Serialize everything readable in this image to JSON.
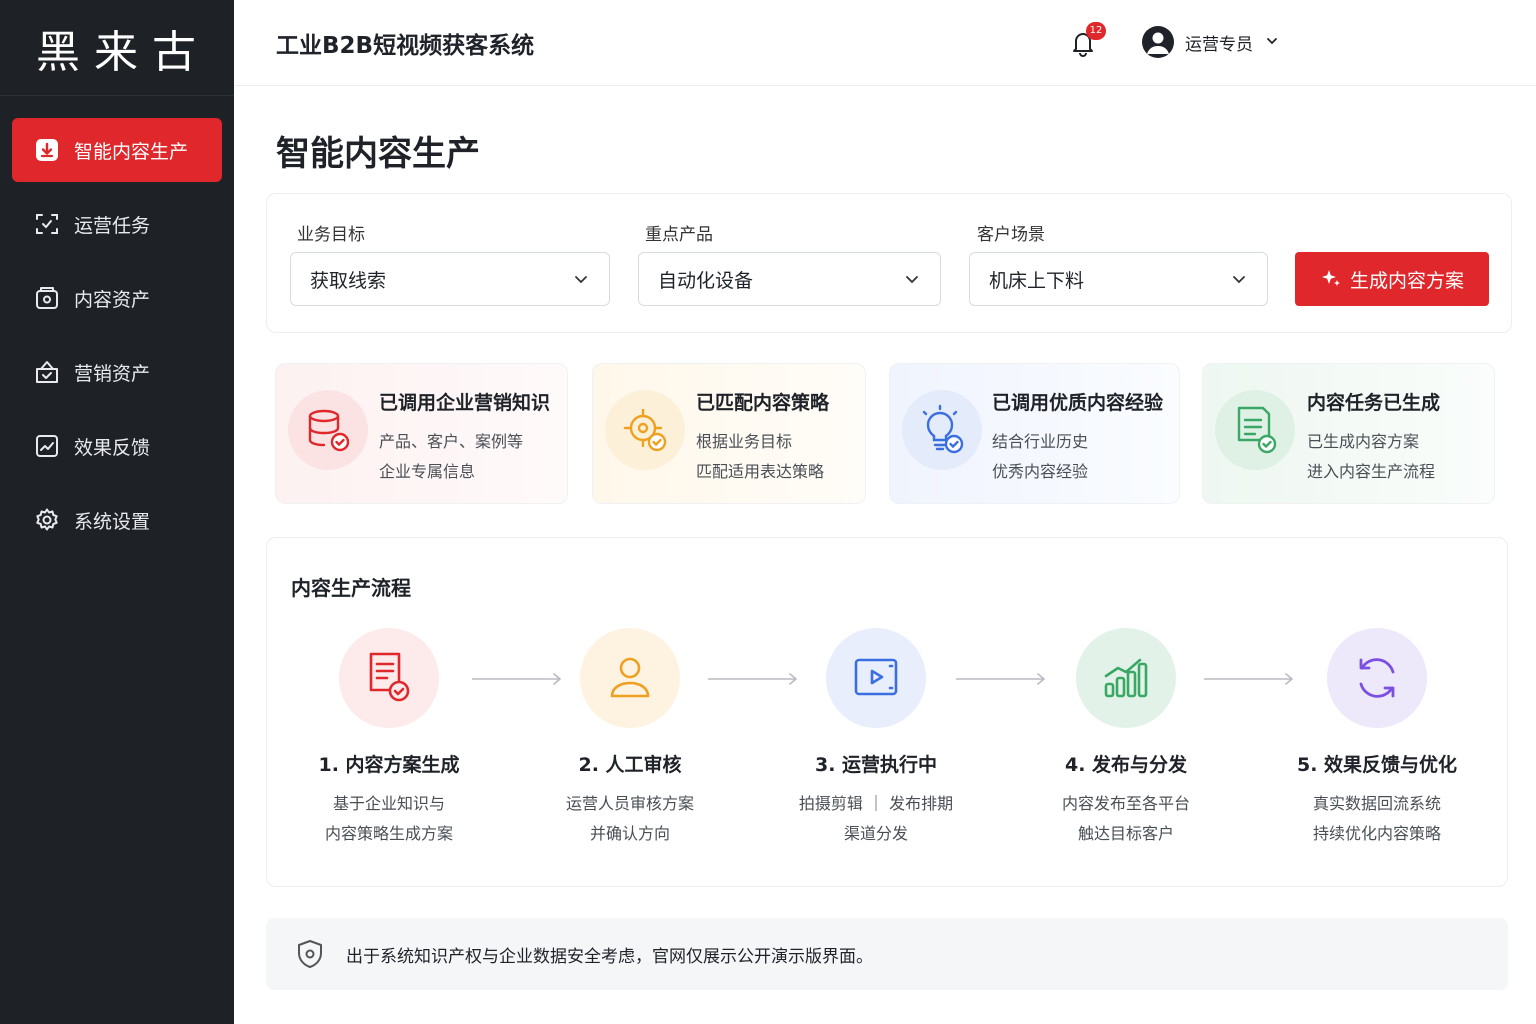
{
  "brand": {
    "logo_text": "黑来古"
  },
  "sidebar": {
    "items": [
      {
        "label": "智能内容生产",
        "active": true,
        "icon": "download-box-icon"
      },
      {
        "label": "运营任务",
        "active": false,
        "icon": "scan-task-icon"
      },
      {
        "label": "内容资产",
        "active": false,
        "icon": "asset-box-icon"
      },
      {
        "label": "营销资产",
        "active": false,
        "icon": "marketing-box-icon"
      },
      {
        "label": "效果反馈",
        "active": false,
        "icon": "chart-feedback-icon"
      },
      {
        "label": "系统设置",
        "active": false,
        "icon": "gear-icon"
      }
    ]
  },
  "header": {
    "title": "工业B2B短视频获客系统",
    "notification_count": "12",
    "user_name": "运营专员"
  },
  "page": {
    "title": "智能内容生产"
  },
  "filters": {
    "goal": {
      "label": "业务目标",
      "value": "获取线索"
    },
    "product": {
      "label": "重点产品",
      "value": "自动化设备"
    },
    "scene": {
      "label": "客户场景",
      "value": "机床上下料"
    },
    "generate_label": "生成内容方案"
  },
  "status_cards": [
    {
      "title": "已调用企业营销知识",
      "line1": "产品、客户、案例等",
      "line2": "企业专属信息",
      "icon": "database-check-icon",
      "color": "#e0272b"
    },
    {
      "title": "已匹配内容策略",
      "line1": "根据业务目标",
      "line2": "匹配适用表达策略",
      "icon": "target-check-icon",
      "color": "#f0a020"
    },
    {
      "title": "已调用优质内容经验",
      "line1": "结合行业历史",
      "line2": "优秀内容经验",
      "icon": "lightbulb-check-icon",
      "color": "#3b6fe0"
    },
    {
      "title": "内容任务已生成",
      "line1": "已生成内容方案",
      "line2": "进入内容生产流程",
      "icon": "document-check-icon",
      "color": "#3aa865"
    }
  ],
  "process": {
    "title": "内容生产流程",
    "steps": [
      {
        "title": "1. 内容方案生成",
        "line1": "基于企业知识与",
        "line2": "内容策略生成方案",
        "icon": "document-check-icon",
        "color": "#e0272b"
      },
      {
        "title": "2. 人工审核",
        "line1": "运营人员审核方案",
        "line2": "并确认方向",
        "icon": "user-icon",
        "color": "#f0a020"
      },
      {
        "title": "3. 运营执行中",
        "line1": "拍摄剪辑 ｜ 发布排期",
        "line2": "渠道分发",
        "icon": "video-play-icon",
        "color": "#3b6fe0"
      },
      {
        "title": "4. 发布与分发",
        "line1": "内容发布至各平台",
        "line2": "触达目标客户",
        "icon": "bar-growth-icon",
        "color": "#3aa865"
      },
      {
        "title": "5. 效果反馈与优化",
        "line1": "真实数据回流系统",
        "line2": "持续优化内容策略",
        "icon": "refresh-cycle-icon",
        "color": "#7b4fe0"
      }
    ]
  },
  "notice": {
    "text": "出于系统知识产权与企业数据安全考虑，官网仅展示公开演示版界面。",
    "icon": "shield-icon"
  }
}
